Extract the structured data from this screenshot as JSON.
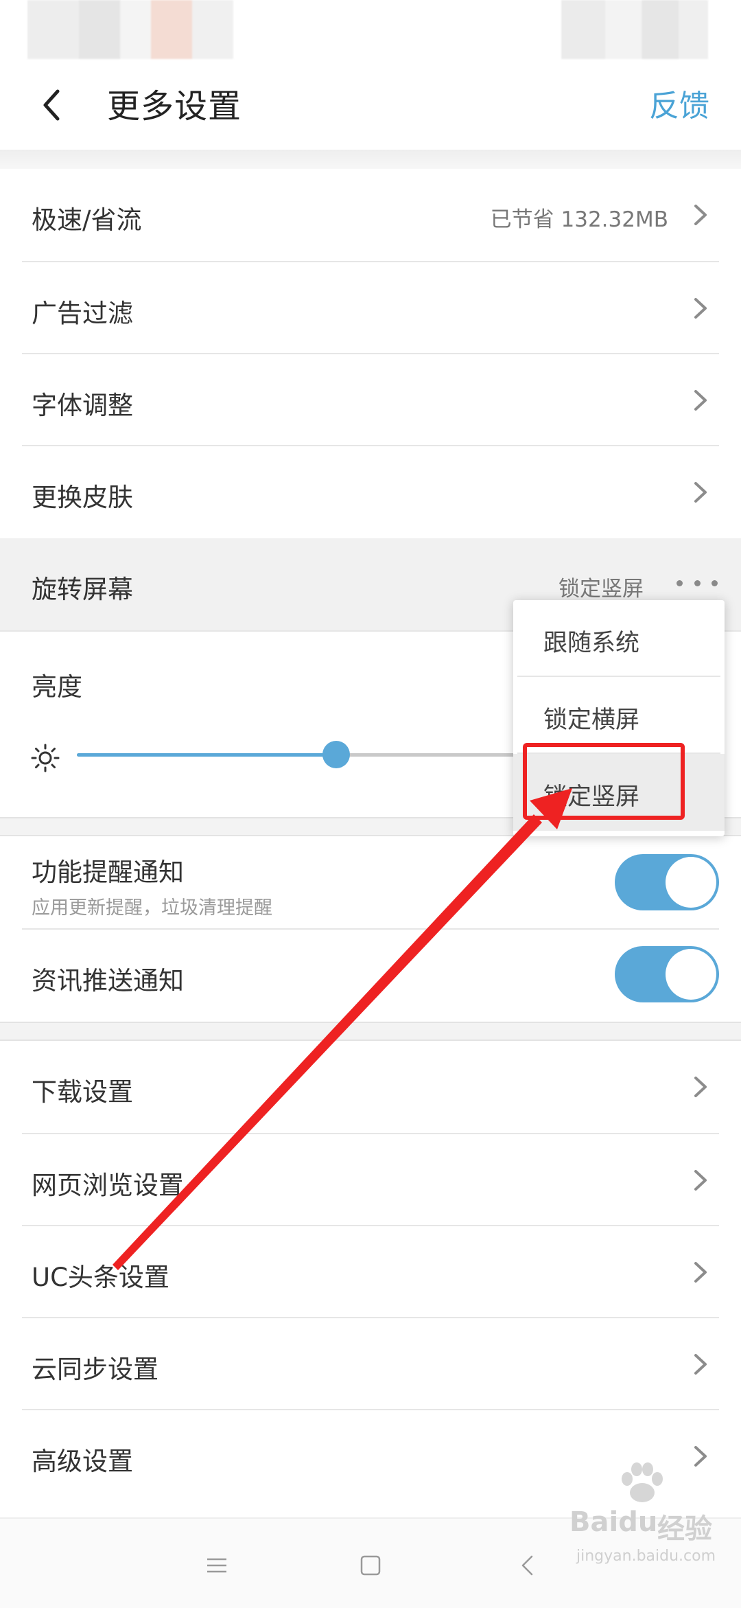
{
  "header": {
    "title": "更多设置",
    "feedback": "反馈"
  },
  "rows_group1": [
    {
      "label": "极速/省流",
      "value": "已节省 132.32MB"
    },
    {
      "label": "广告过滤",
      "value": ""
    },
    {
      "label": "字体调整",
      "value": ""
    },
    {
      "label": "更换皮肤",
      "value": ""
    }
  ],
  "rotate": {
    "label": "旋转屏幕",
    "value": "锁定竖屏"
  },
  "brightness": {
    "label": "亮度",
    "level_fraction": 0.59
  },
  "popup": {
    "options": [
      "跟随系统",
      "锁定横屏",
      "锁定竖屏"
    ],
    "selected": "锁定竖屏"
  },
  "notifications": [
    {
      "label": "功能提醒通知",
      "sub": "应用更新提醒，垃圾清理提醒",
      "enabled": true
    },
    {
      "label": "资讯推送通知",
      "sub": "",
      "enabled": true
    }
  ],
  "rows_group2": [
    {
      "label": "下载设置"
    },
    {
      "label": "网页浏览设置"
    },
    {
      "label": "UC头条设置"
    },
    {
      "label": "云同步设置"
    },
    {
      "label": "高级设置"
    }
  ],
  "watermark": {
    "brand": "Baidu",
    "brand_cn": "经验",
    "site": "jingyan.baidu.com"
  },
  "colors": {
    "accent": "#5aa8d8",
    "annotation": "#ee2222"
  }
}
